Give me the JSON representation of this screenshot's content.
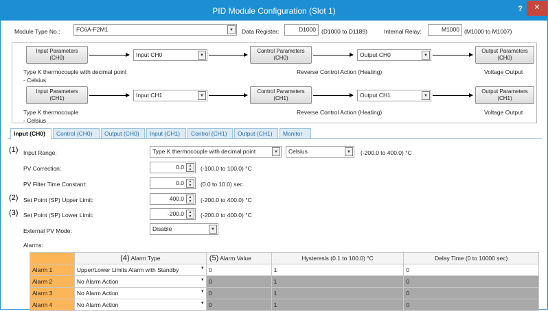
{
  "window": {
    "title": "PID Module Configuration (Slot 1)",
    "help": "?",
    "close": "✕"
  },
  "module": {
    "type_label": "Module Type No.:",
    "type_value": "FC6A-F2M1",
    "data_register_label": "Data Register:",
    "data_register_value": "D1000",
    "data_register_range": "(D1000 to D1189)",
    "internal_relay_label": "Internal Relay:",
    "internal_relay_value": "M1000",
    "internal_relay_range": "(M1000 to M1007)"
  },
  "flow": {
    "ch0": {
      "input_params": [
        "Input Parameters",
        "(CH0)"
      ],
      "input_select": "Input CH0",
      "control_params": [
        "Control Parameters",
        "(CH0)"
      ],
      "output_select": "Output CH0",
      "output_params": [
        "Output Parameters",
        "(CH0)"
      ],
      "input_desc": [
        "Type K thermocouple with decimal point",
        "- Celsius"
      ],
      "control_desc": "Reverse Control Action (Heating)",
      "output_desc": "Voltage Output"
    },
    "ch1": {
      "input_params": [
        "Input Parameters",
        "(CH1)"
      ],
      "input_select": "Input CH1",
      "control_params": [
        "Control Parameters",
        "(CH1)"
      ],
      "output_select": "Output CH1",
      "output_params": [
        "Output Parameters",
        "(CH1)"
      ],
      "input_desc": [
        "Type K thermocouple",
        "- Celsius"
      ],
      "control_desc": "Reverse Control Action (Heating)",
      "output_desc": "Voltage Output"
    }
  },
  "tabs": [
    "Input (CH0)",
    "Control (CH0)",
    "Output (CH0)",
    "Input (CH1)",
    "Control (CH1)",
    "Output (CH1)",
    "Monitor"
  ],
  "form": {
    "input_range": {
      "marker": "(1)",
      "label": "Input Range:",
      "type": "Type K thermocouple with decimal point",
      "unit": "Celsius",
      "range": "(-200.0 to 400.0) °C"
    },
    "pv_correction": {
      "label": "PV Correction:",
      "value": "0.0",
      "range": "(-100.0 to 100.0) °C"
    },
    "pv_filter": {
      "label": "PV Filter Time Constant:",
      "value": "0.0",
      "range": "(0.0 to 10.0) sec"
    },
    "sp_upper": {
      "marker": "(2)",
      "label": "Set Point (SP) Upper Limit:",
      "value": "400.0",
      "range": "(-200.0 to 400.0) °C"
    },
    "sp_lower": {
      "marker": "(3)",
      "label": "Set Point (SP) Lower Limit:",
      "value": "-200.0",
      "range": "(-200.0 to 400.0) °C"
    },
    "external_pv": {
      "label": "External PV Mode:",
      "value": "Disable"
    },
    "alarms_label": "Alarms:"
  },
  "alarms": {
    "headers": {
      "type_marker": "(4)",
      "type": "Alarm Type",
      "value_marker": "(5)",
      "value": "Alarm Value",
      "hysteresis": "Hysteresis (0.1 to 100.0) °C",
      "delay": "Delay Time (0 to 10000 sec)"
    },
    "rows": [
      {
        "name": "Alarm 1",
        "type": "Upper/Lower Limits Alarm with Standby",
        "value": "0",
        "hysteresis": "1",
        "delay": "0"
      },
      {
        "name": "Alarm 2",
        "type": "No Alarm Action",
        "value": "0",
        "hysteresis": "1",
        "delay": "0"
      },
      {
        "name": "Alarm 3",
        "type": "No Alarm Action",
        "value": "0",
        "hysteresis": "1",
        "delay": "0"
      },
      {
        "name": "Alarm 4",
        "type": "No Alarm Action",
        "value": "0",
        "hysteresis": "1",
        "delay": "0"
      }
    ]
  }
}
